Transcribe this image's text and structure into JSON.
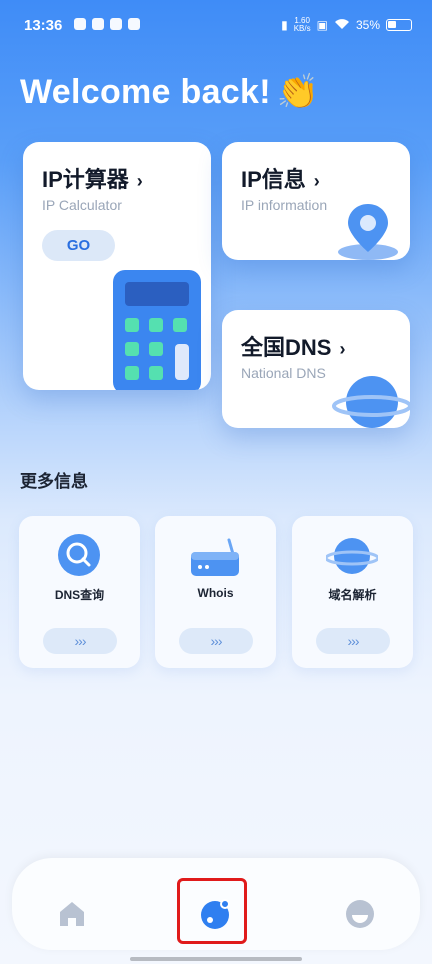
{
  "status_bar": {
    "time": "13:36",
    "net_speed_top": "1.60",
    "net_speed_unit": "KB/s",
    "battery_percent": "35%",
    "battery_level": 0.35
  },
  "welcome": {
    "text": "Welcome back!",
    "emoji": "👏"
  },
  "cards": {
    "ip_calc": {
      "title": "IP计算器",
      "subtitle": "IP Calculator",
      "button": "GO",
      "chevron": "›"
    },
    "ip_info": {
      "title": "IP信息",
      "subtitle": "IP information",
      "chevron": "›"
    },
    "dns": {
      "title": "全国DNS",
      "subtitle": "National DNS",
      "chevron": "›"
    }
  },
  "more_info": {
    "title": "更多信息",
    "items": [
      {
        "label": "DNS查询",
        "arrow": "›››",
        "icon": "magnifier-icon"
      },
      {
        "label": "Whois",
        "arrow": "›››",
        "icon": "router-icon"
      },
      {
        "label": "域名解析",
        "arrow": "›››",
        "icon": "planet-icon"
      }
    ]
  },
  "nav": {
    "items": [
      "home-icon",
      "discover-icon",
      "profile-icon"
    ],
    "active": "discover-icon"
  },
  "colors": {
    "accent": "#3f8cf7",
    "highlight": "#e01b1b"
  }
}
